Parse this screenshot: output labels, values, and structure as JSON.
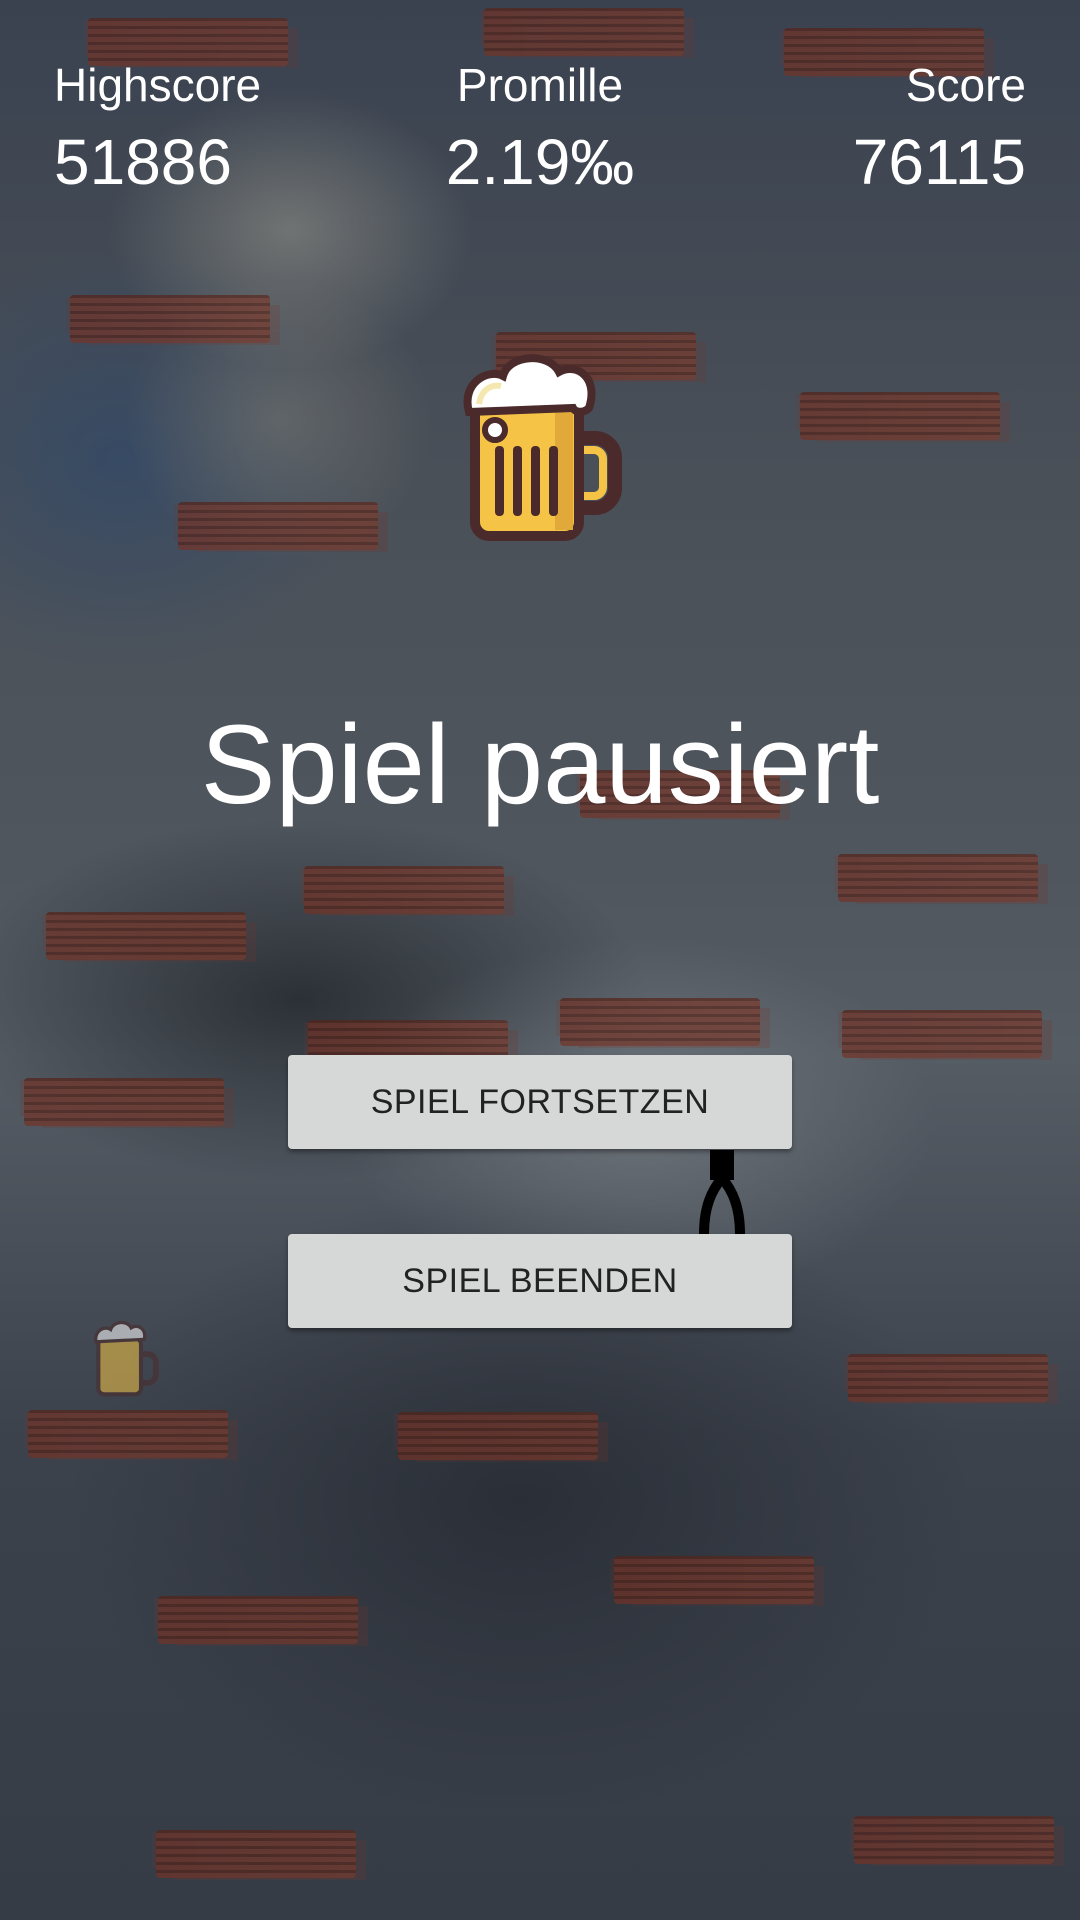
{
  "hud": {
    "highscore_label": "Highscore",
    "highscore_value": "51886",
    "promille_label": "Promille",
    "promille_value": "2.19‰",
    "score_label": "Score",
    "score_value": "76115"
  },
  "pause": {
    "title": "Spiel pausiert"
  },
  "buttons": {
    "continue_label": "SPIEL FORTSETZEN",
    "quit_label": "SPIEL BEENDEN"
  },
  "icons": {
    "beer": "beer-mug-icon",
    "player": "stick-figure-legs"
  },
  "colors": {
    "button_bg": "#d6d7d7",
    "button_text": "#222222",
    "plank": "#7a3a2c",
    "beer_glass": "#f5c447",
    "beer_outline": "#4a2a2a",
    "foam": "#ffffff"
  }
}
